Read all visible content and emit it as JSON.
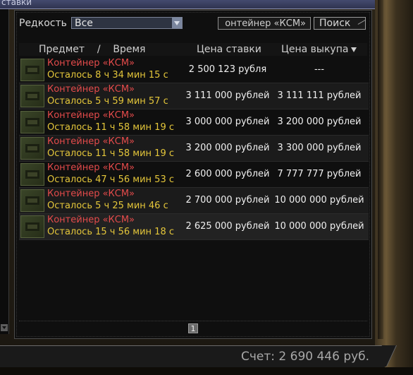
{
  "window": {
    "title": "ставки"
  },
  "filters": {
    "rarity_label": "Редкость",
    "rarity_value": "Все",
    "search_value": "онтейнер «КСМ»",
    "search_button": "Поиск"
  },
  "columns": {
    "item_time": "Предмет    /    Время",
    "bid": "Цена ставки",
    "buyout": "Цена выкупа"
  },
  "rows": [
    {
      "name": "Контейнер «КСМ»",
      "time": "Осталось 8 ч 34 мин 15 с",
      "bid": "2 500 123 рубля",
      "buyout": "---"
    },
    {
      "name": "Контейнер «КСМ»",
      "time": "Осталось 5 ч 59 мин 57 с",
      "bid": "3 111 000 рублей",
      "buyout": "3 111 111 рублей"
    },
    {
      "name": "Контейнер «КСМ»",
      "time": "Осталось 11 ч 58 мин 19 с",
      "bid": "3 000 000 рублей",
      "buyout": "3 200 000 рублей"
    },
    {
      "name": "Контейнер «КСМ»",
      "time": "Осталось 11 ч 58 мин 19 с",
      "bid": "3 200 000 рублей",
      "buyout": "3 300 000 рублей"
    },
    {
      "name": "Контейнер «КСМ»",
      "time": "Осталось 47 ч 56 мин 53 с",
      "bid": "2 600 000 рублей",
      "buyout": "7 777 777 рублей"
    },
    {
      "name": "Контейнер «КСМ»",
      "time": "Осталось 5 ч 25 мин 46 с",
      "bid": "2 700 000 рублей",
      "buyout": "10 000 000 рублей"
    },
    {
      "name": "Контейнер «КСМ»",
      "time": "Осталось 15 ч 56 мин 18 с",
      "bid": "2 625 000 рублей",
      "buyout": "10 000 000 рублей"
    }
  ],
  "pager": {
    "current_page": "1"
  },
  "footer": {
    "balance": "Счет: 2 690 446 руб."
  },
  "colors": {
    "item_name": "#e44b4b",
    "time_left": "#e4c63a",
    "price": "#f0f0f0"
  },
  "icons": {
    "item_thumbnail": "container-icon",
    "sort": "sort-desc-icon",
    "dropdown": "chevron-down-icon"
  }
}
